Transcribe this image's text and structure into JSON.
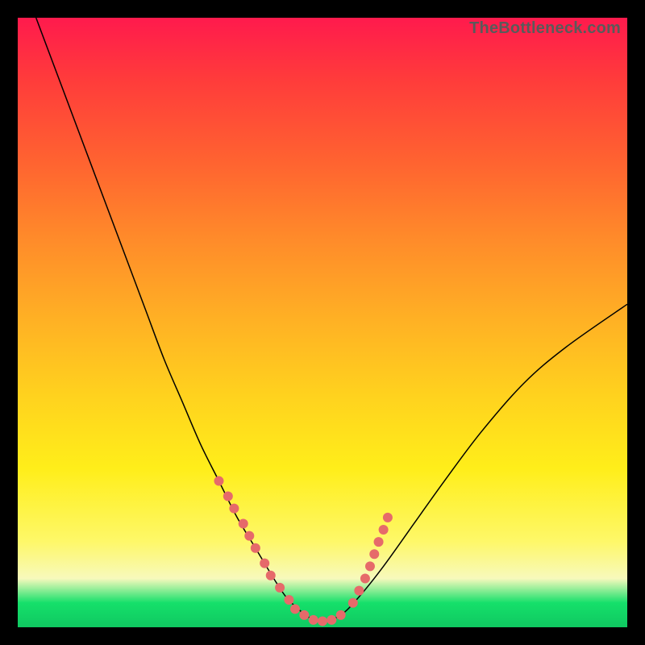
{
  "watermark": "TheBottleneck.com",
  "colors": {
    "curve": "#000000",
    "dot": "#e66a6a",
    "frame_bg_top": "#ff1a4d",
    "frame_bg_bottom": "#0fc861"
  },
  "chart_data": {
    "type": "line",
    "title": "",
    "xlabel": "",
    "ylabel": "",
    "xlim": [
      0,
      100
    ],
    "ylim": [
      0,
      100
    ],
    "grid": false,
    "series": [
      {
        "name": "bottleneck-curve",
        "x": [
          3,
          6,
          9,
          12,
          15,
          18,
          21,
          24,
          27,
          30,
          33,
          36,
          39,
          42,
          44,
          46,
          48,
          50,
          53,
          56,
          60,
          65,
          70,
          76,
          83,
          90,
          100
        ],
        "values": [
          100,
          92,
          84,
          76,
          68,
          60,
          52,
          44,
          37,
          30,
          24,
          18,
          13,
          8,
          5,
          3,
          1.5,
          1,
          2,
          5,
          10,
          17,
          24,
          32,
          40,
          46,
          53
        ]
      }
    ],
    "markers": [
      {
        "x": 33,
        "y": 24
      },
      {
        "x": 34.5,
        "y": 21.5
      },
      {
        "x": 35.5,
        "y": 19.5
      },
      {
        "x": 37,
        "y": 17
      },
      {
        "x": 38,
        "y": 15
      },
      {
        "x": 39,
        "y": 13
      },
      {
        "x": 40.5,
        "y": 10.5
      },
      {
        "x": 41.5,
        "y": 8.5
      },
      {
        "x": 43,
        "y": 6.5
      },
      {
        "x": 44.5,
        "y": 4.5
      },
      {
        "x": 45.5,
        "y": 3
      },
      {
        "x": 47,
        "y": 2
      },
      {
        "x": 48.5,
        "y": 1.2
      },
      {
        "x": 50,
        "y": 1
      },
      {
        "x": 51.5,
        "y": 1.2
      },
      {
        "x": 53,
        "y": 2
      },
      {
        "x": 55,
        "y": 4
      },
      {
        "x": 56,
        "y": 6
      },
      {
        "x": 57,
        "y": 8
      },
      {
        "x": 57.8,
        "y": 10
      },
      {
        "x": 58.5,
        "y": 12
      },
      {
        "x": 59.2,
        "y": 14
      },
      {
        "x": 60,
        "y": 16
      },
      {
        "x": 60.7,
        "y": 18
      }
    ]
  }
}
